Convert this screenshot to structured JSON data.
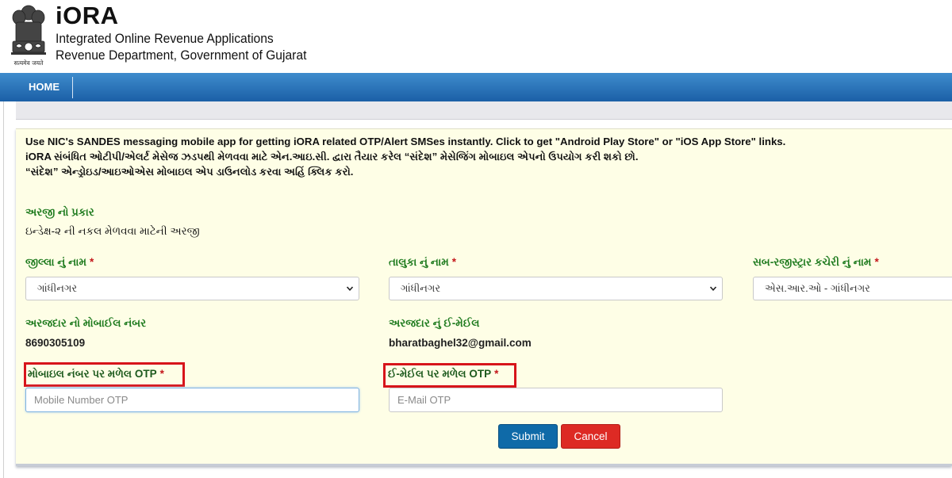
{
  "header": {
    "emblem_caption": "सत्यमेव जयते",
    "title": "iORA",
    "subtitle_line1": "Integrated Online Revenue Applications",
    "subtitle_line2": "Revenue Department, Government of Gujarat"
  },
  "nav": {
    "home_label": "HOME"
  },
  "notice": {
    "line1": "Use NIC's SANDES messaging mobile app for getting iORA related OTP/Alert SMSes instantly. Click to get \"Android Play Store\" or \"iOS App Store\" links.",
    "line2": "iORA સંબંધિત ઓટીપી/એલર્ટ મેસેજ ઝડપથી મેળવવા માટે એન.આઇ.સી. દ્વારા તૈયાર કરેલ “સંદેશ” મેસેજિંગ મોબાઇલ એપનો ઉપયોગ કરી શકો છો.",
    "line3": "“સંદેશ” એન્ડ્રોઇડ/આઇઓએસ મોબાઇલ એપ ડાઉનલોડ કરવા અહિં ક્લિક કરો."
  },
  "form": {
    "application_type_label": "અરજી નો પ્રકાર",
    "application_type_value": "ઇન્ડેક્ષ-૨ ની નકલ મેળવવા માટેની અરજી",
    "required_marker": "*",
    "district": {
      "label": "જીલ્લા નું નામ",
      "selected": "ગાંધીનગર"
    },
    "taluka": {
      "label": "તાલુકા નું નામ",
      "selected": "ગાંધીનગર"
    },
    "sub_registrar": {
      "label": "સબ-રજીસ્ટ્રાર કચેરી નું નામ",
      "selected": "એસ.આર.ઓ - ગાંધીનગર"
    },
    "mobile": {
      "label": "અરજદાર નો મોબાઈલ નંબર",
      "value": "8690305109"
    },
    "email": {
      "label": "અરજદાર નું ઈ-મેઈલ",
      "value": "bharatbaghel32@gmail.com"
    },
    "mobile_otp": {
      "label": "મોબાઇલ નંબર પર મળેલ OTP",
      "placeholder": "Mobile Number OTP",
      "value": ""
    },
    "email_otp": {
      "label": "ઈ-મેઈલ પર મળેલ OTP",
      "placeholder": "E-Mail OTP",
      "value": ""
    },
    "submit_label": "Submit",
    "cancel_label": "Cancel"
  },
  "colors": {
    "nav_blue": "#1b5fa6",
    "panel_bg": "#fefee6",
    "label_green": "#1d7a1d",
    "required_red": "#c4171b",
    "highlight_red": "#d7141a",
    "submit_blue": "#0f6aa8",
    "cancel_red": "#dd2a24"
  },
  "icons": [
    "ashoka-emblem-icon",
    "chevron-down-icon"
  ]
}
